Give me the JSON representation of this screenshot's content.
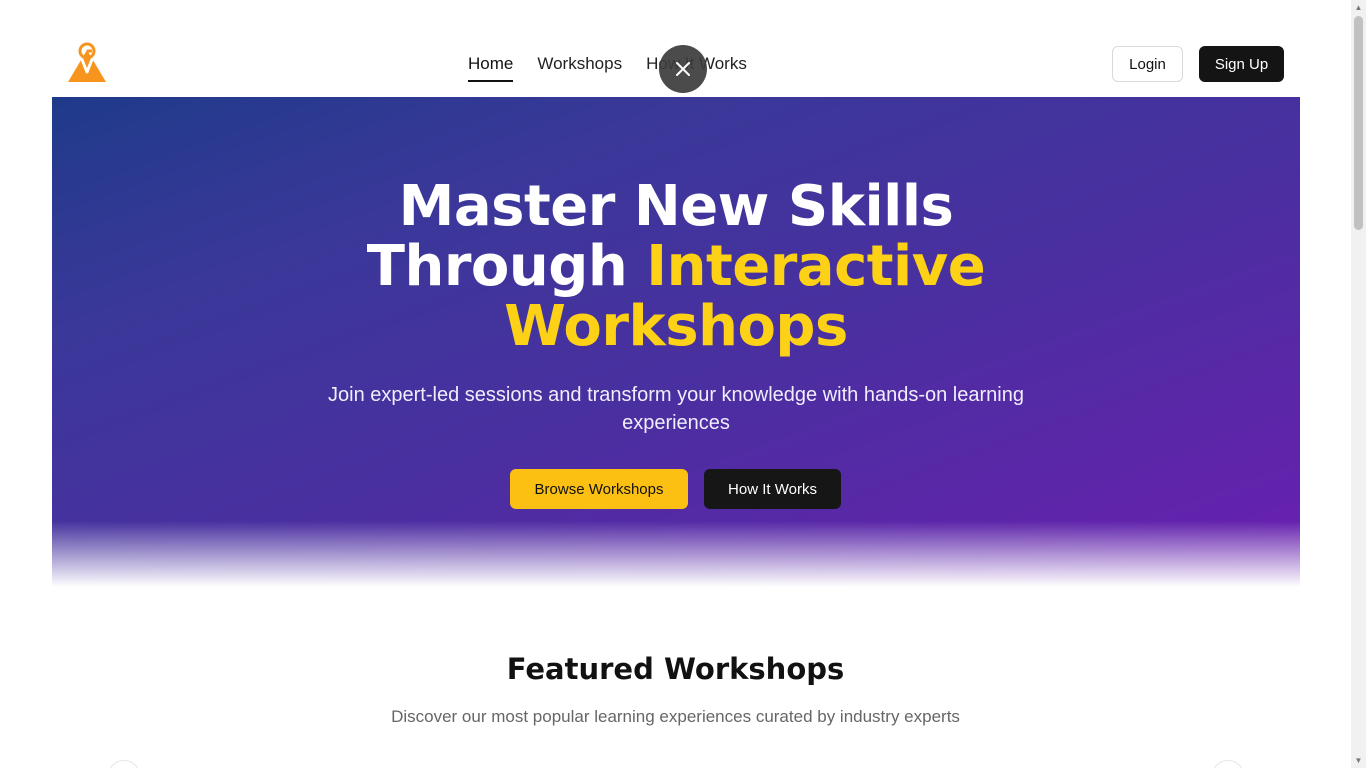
{
  "nav": {
    "links": [
      {
        "label": "Home",
        "active": true
      },
      {
        "label": "Workshops",
        "active": false
      },
      {
        "label": "How It Works",
        "active": false
      }
    ],
    "login_label": "Login",
    "signup_label": "Sign Up"
  },
  "overlay": {
    "close_icon": "close-icon"
  },
  "hero": {
    "title_line1": "Master New Skills",
    "title_line2_plain": "Through ",
    "title_line2_accent": "Interactive",
    "title_line3_accent": "Workshops",
    "subtitle": "Join expert-led sessions and transform your knowledge with hands-on learning experiences",
    "browse_label": "Browse Workshops",
    "how_label": "How It Works"
  },
  "featured": {
    "title": "Featured Workshops",
    "subtitle": "Discover our most popular learning experiences curated by industry experts"
  },
  "colors": {
    "accent_yellow": "#fcd116",
    "button_yellow": "#fbc012",
    "hero_gradient_start": "#1f3a8a",
    "hero_gradient_end": "#6a1fb0",
    "logo_orange": "#f7941d",
    "dark_button": "#141414"
  }
}
